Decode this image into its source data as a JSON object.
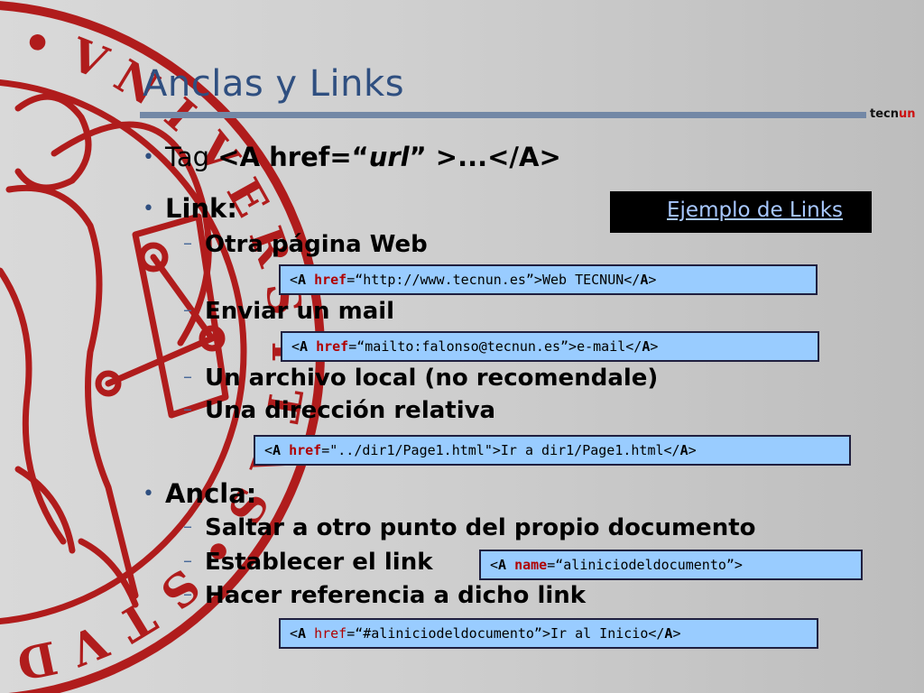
{
  "slide": {
    "title": "Anclas y Links",
    "logo": {
      "part1": "tecn",
      "part2": "un"
    },
    "bullet_symbol": "•",
    "dash_symbol": "–",
    "tag_line": {
      "prefix": "Tag ",
      "code_a": "<A href=“",
      "code_url": "url",
      "code_b": "” >...</A>"
    },
    "link_heading": "Link:",
    "link_items": [
      "Otra página Web",
      "Enviar un mail",
      "Un archivo local (no recomendale)",
      "Una dirección relativa"
    ],
    "anchor_heading": "Ancla:",
    "anchor_items": [
      "Saltar a otro punto del propio documento",
      "Establecer el link",
      "Hacer referencia a dicho link"
    ],
    "example_link": "Ejemplo de Links",
    "code_examples": [
      {
        "open": "<",
        "tag": "A",
        "attr": "href",
        "value": "=“http://www.tecnun.es”>Web TECNUN</",
        "close_tag": "A",
        "end": ">"
      },
      {
        "open": "<",
        "tag": "A",
        "attr": "href",
        "value": "=“mailto:falonso@tecnun.es”>e-mail</",
        "close_tag": "A",
        "end": ">"
      },
      {
        "open": "<",
        "tag": "A",
        "attr": "href",
        "value": "=\"../dir1/Page1.html\">Ir a dir1/Page1.html</",
        "close_tag": "A",
        "end": ">"
      },
      {
        "open": "<",
        "tag": "A",
        "attr": "name",
        "value": "=“aliniciodeldocumento”>",
        "close_tag": "",
        "end": ""
      },
      {
        "open": "<",
        "tag": "A",
        "attr": "href",
        "value": "=“#aliniciodeldocumento”>Ir al Inicio</",
        "close_tag": "A",
        "end": ">"
      }
    ],
    "seal_letters": [
      "S",
      "•",
      "V",
      "N",
      "I",
      "V",
      "E",
      "R",
      "S",
      "I",
      "T",
      "A",
      "S",
      "•",
      "S",
      "T",
      "V",
      "D",
      "I"
    ],
    "colors": {
      "title": "#2f4f80",
      "seal": "#b01c1c",
      "code_bg": "#99ccff",
      "keyword": "#b00000",
      "link": "#a8c8ff"
    }
  }
}
